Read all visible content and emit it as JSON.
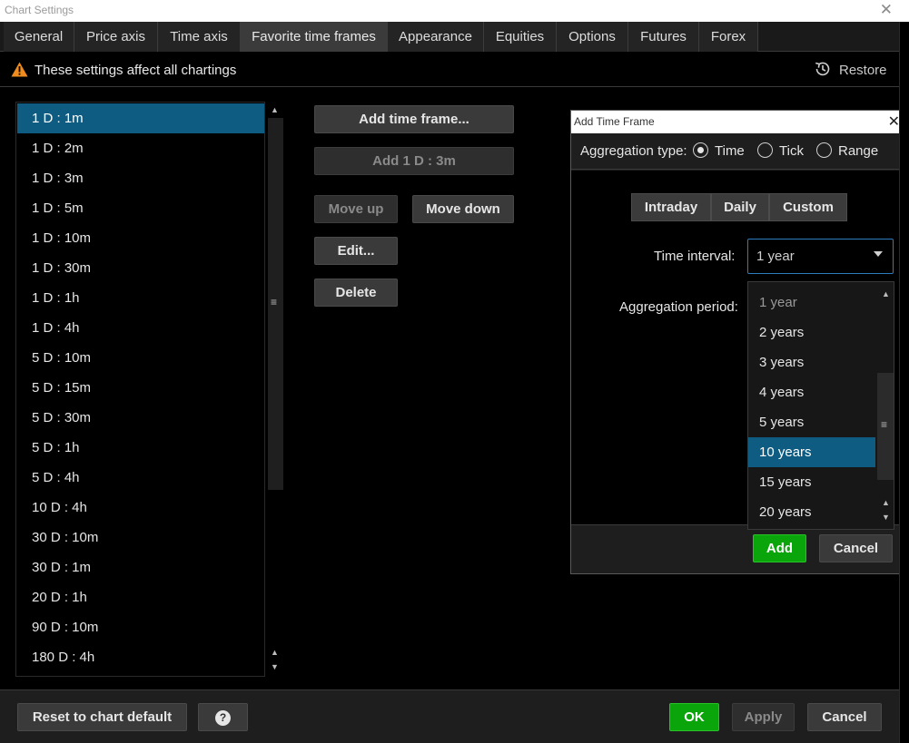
{
  "window": {
    "title": "Chart Settings",
    "close_glyph": "✕"
  },
  "tabs": [
    {
      "label": "General"
    },
    {
      "label": "Price axis"
    },
    {
      "label": "Time axis"
    },
    {
      "label": "Favorite time frames",
      "active": true
    },
    {
      "label": "Appearance"
    },
    {
      "label": "Equities"
    },
    {
      "label": "Options"
    },
    {
      "label": "Futures"
    },
    {
      "label": "Forex"
    }
  ],
  "info": {
    "text": "These settings affect all chartings",
    "restore_label": "Restore",
    "warning_color": "#f08c1e"
  },
  "time_frames": [
    {
      "label": "1 D : 1m",
      "selected": true
    },
    {
      "label": "1 D : 2m"
    },
    {
      "label": "1 D : 3m"
    },
    {
      "label": "1 D : 5m"
    },
    {
      "label": "1 D : 10m"
    },
    {
      "label": "1 D : 30m"
    },
    {
      "label": "1 D : 1h"
    },
    {
      "label": "1 D : 4h"
    },
    {
      "label": "5 D : 10m"
    },
    {
      "label": "5 D : 15m"
    },
    {
      "label": "5 D : 30m"
    },
    {
      "label": "5 D : 1h"
    },
    {
      "label": "5 D : 4h"
    },
    {
      "label": "10 D : 4h"
    },
    {
      "label": "30 D : 10m"
    },
    {
      "label": "30 D : 1m"
    },
    {
      "label": "20 D : 1h"
    },
    {
      "label": "90 D : 10m"
    },
    {
      "label": "180 D : 4h"
    }
  ],
  "actions": {
    "add_time_frame": "Add time frame...",
    "add_quick": "Add 1 D : 3m",
    "move_up": "Move up",
    "move_down": "Move down",
    "edit": "Edit...",
    "delete": "Delete"
  },
  "dialog": {
    "title": "Add Time Frame",
    "close_glyph": "✕",
    "aggregation_label": "Aggregation type:",
    "aggregation_options": [
      {
        "label": "Time",
        "checked": true
      },
      {
        "label": "Tick"
      },
      {
        "label": "Range"
      }
    ],
    "segments": [
      "Intraday",
      "Daily",
      "Custom"
    ],
    "time_interval_label": "Time interval:",
    "time_interval_value": "1 year",
    "aggregation_period_label": "Aggregation period:",
    "interval_options": [
      {
        "label": "1 year",
        "dim": true
      },
      {
        "label": "2 years"
      },
      {
        "label": "3 years"
      },
      {
        "label": "4 years"
      },
      {
        "label": "5 years"
      },
      {
        "label": "10 years",
        "selected": true
      },
      {
        "label": "15 years"
      },
      {
        "label": "20 years"
      }
    ],
    "add_label": "Add",
    "cancel_label": "Cancel"
  },
  "footer": {
    "reset_label": "Reset to chart default",
    "help_glyph": "?",
    "ok_label": "OK",
    "apply_label": "Apply",
    "cancel_label": "Cancel"
  },
  "colors": {
    "accent_green": "#0aa50a",
    "selection_blue": "#0f5c82",
    "focus_blue": "#2e7cc0"
  }
}
